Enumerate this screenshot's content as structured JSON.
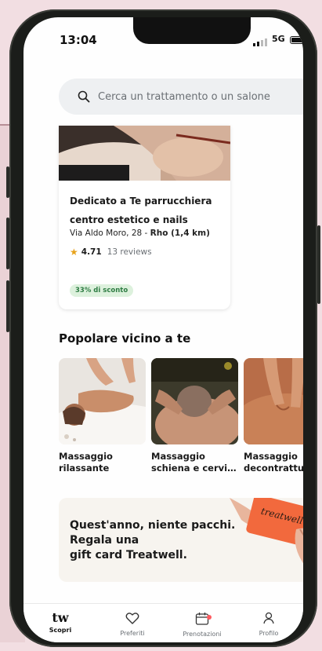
{
  "status_bar": {
    "time": "13:04",
    "network": "5G"
  },
  "search": {
    "placeholder": "Cerca un trattamento o un salone",
    "icon": "search-icon"
  },
  "featured_salon": {
    "name": "Dedicato a Te parrucchiera centro estetico e nails",
    "address": "Via Aldo Moro, 28 - ",
    "city_distance": "Rho (1,4 km)",
    "rating": "4.71",
    "reviews": "13 reviews",
    "discount_badge": "33% di sconto"
  },
  "popular": {
    "title": "Popolare vicino a te",
    "items": [
      {
        "label_line1": "Massaggio",
        "label_line2": "rilassante"
      },
      {
        "label_line1": "Massaggio",
        "label_line2": "schiena e cervi…"
      },
      {
        "label_line1": "Massaggio",
        "label_line2": "decontrattura…"
      }
    ]
  },
  "promo": {
    "line1": "Quest'anno, niente pacchi.",
    "line2": "Regala una",
    "line3": "gift card Treatwell.",
    "card_brand": "treatwell"
  },
  "tab_bar": {
    "items": [
      {
        "label": "Scopri",
        "icon": "tw-logo",
        "active": true
      },
      {
        "label": "Preferiti",
        "icon": "heart-icon"
      },
      {
        "label": "Prenotazioni",
        "icon": "calendar-icon"
      },
      {
        "label": "Profilo",
        "icon": "person-icon"
      }
    ],
    "logo_text": "tw"
  },
  "colors": {
    "discount_bg": "#ddf1dd",
    "discount_text": "#2f7d44",
    "star": "#e7a21b",
    "notification_dot": "#ff5a5f",
    "gift_card": "#f2693d"
  }
}
